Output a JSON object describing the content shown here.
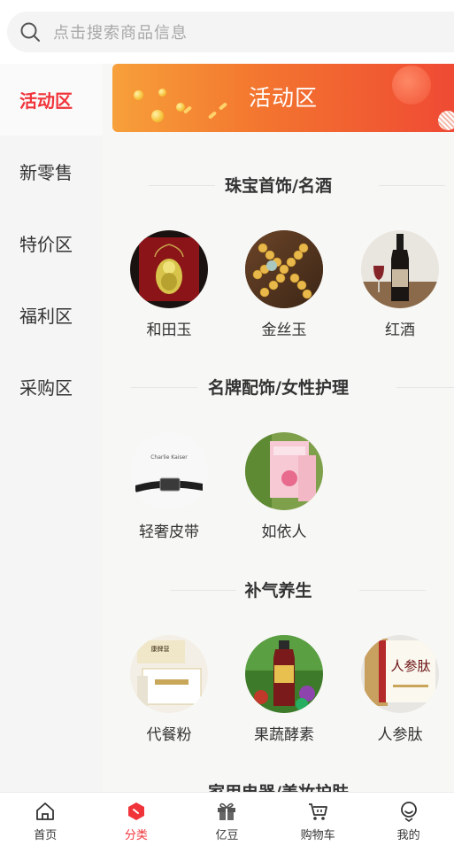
{
  "search": {
    "placeholder": "点击搜索商品信息"
  },
  "sidebar": {
    "items": [
      {
        "label": "活动区",
        "active": true
      },
      {
        "label": "新零售",
        "active": false
      },
      {
        "label": "特价区",
        "active": false
      },
      {
        "label": "福利区",
        "active": false
      },
      {
        "label": "采购区",
        "active": false
      }
    ]
  },
  "banner": {
    "title": "活动区"
  },
  "sections": [
    {
      "title": "珠宝首饰/名酒",
      "products": [
        "和田玉",
        "金丝玉",
        "红酒"
      ]
    },
    {
      "title": "名牌配饰/女性护理",
      "products": [
        "轻奢皮带",
        "如依人"
      ]
    },
    {
      "title": "补气养生",
      "products": [
        "代餐粉",
        "果蔬酵素",
        "人参肽"
      ]
    },
    {
      "title": "家用电器/美妆护肤",
      "products": []
    }
  ],
  "product_images": {
    "belt_brand": "Charlie Kaiser",
    "ginseng_text": "人参肽",
    "meal_brand": "康牌营"
  },
  "bottom_nav": {
    "items": [
      {
        "label": "首页",
        "icon": "home-icon",
        "active": false
      },
      {
        "label": "分类",
        "icon": "category-icon",
        "active": true
      },
      {
        "label": "亿豆",
        "icon": "gift-icon",
        "active": false
      },
      {
        "label": "购物车",
        "icon": "cart-icon",
        "active": false
      },
      {
        "label": "我的",
        "icon": "profile-icon",
        "active": false
      }
    ]
  },
  "colors": {
    "accent": "#f0343a",
    "banner_start": "#f7a03a",
    "banner_end": "#ef4a34"
  }
}
